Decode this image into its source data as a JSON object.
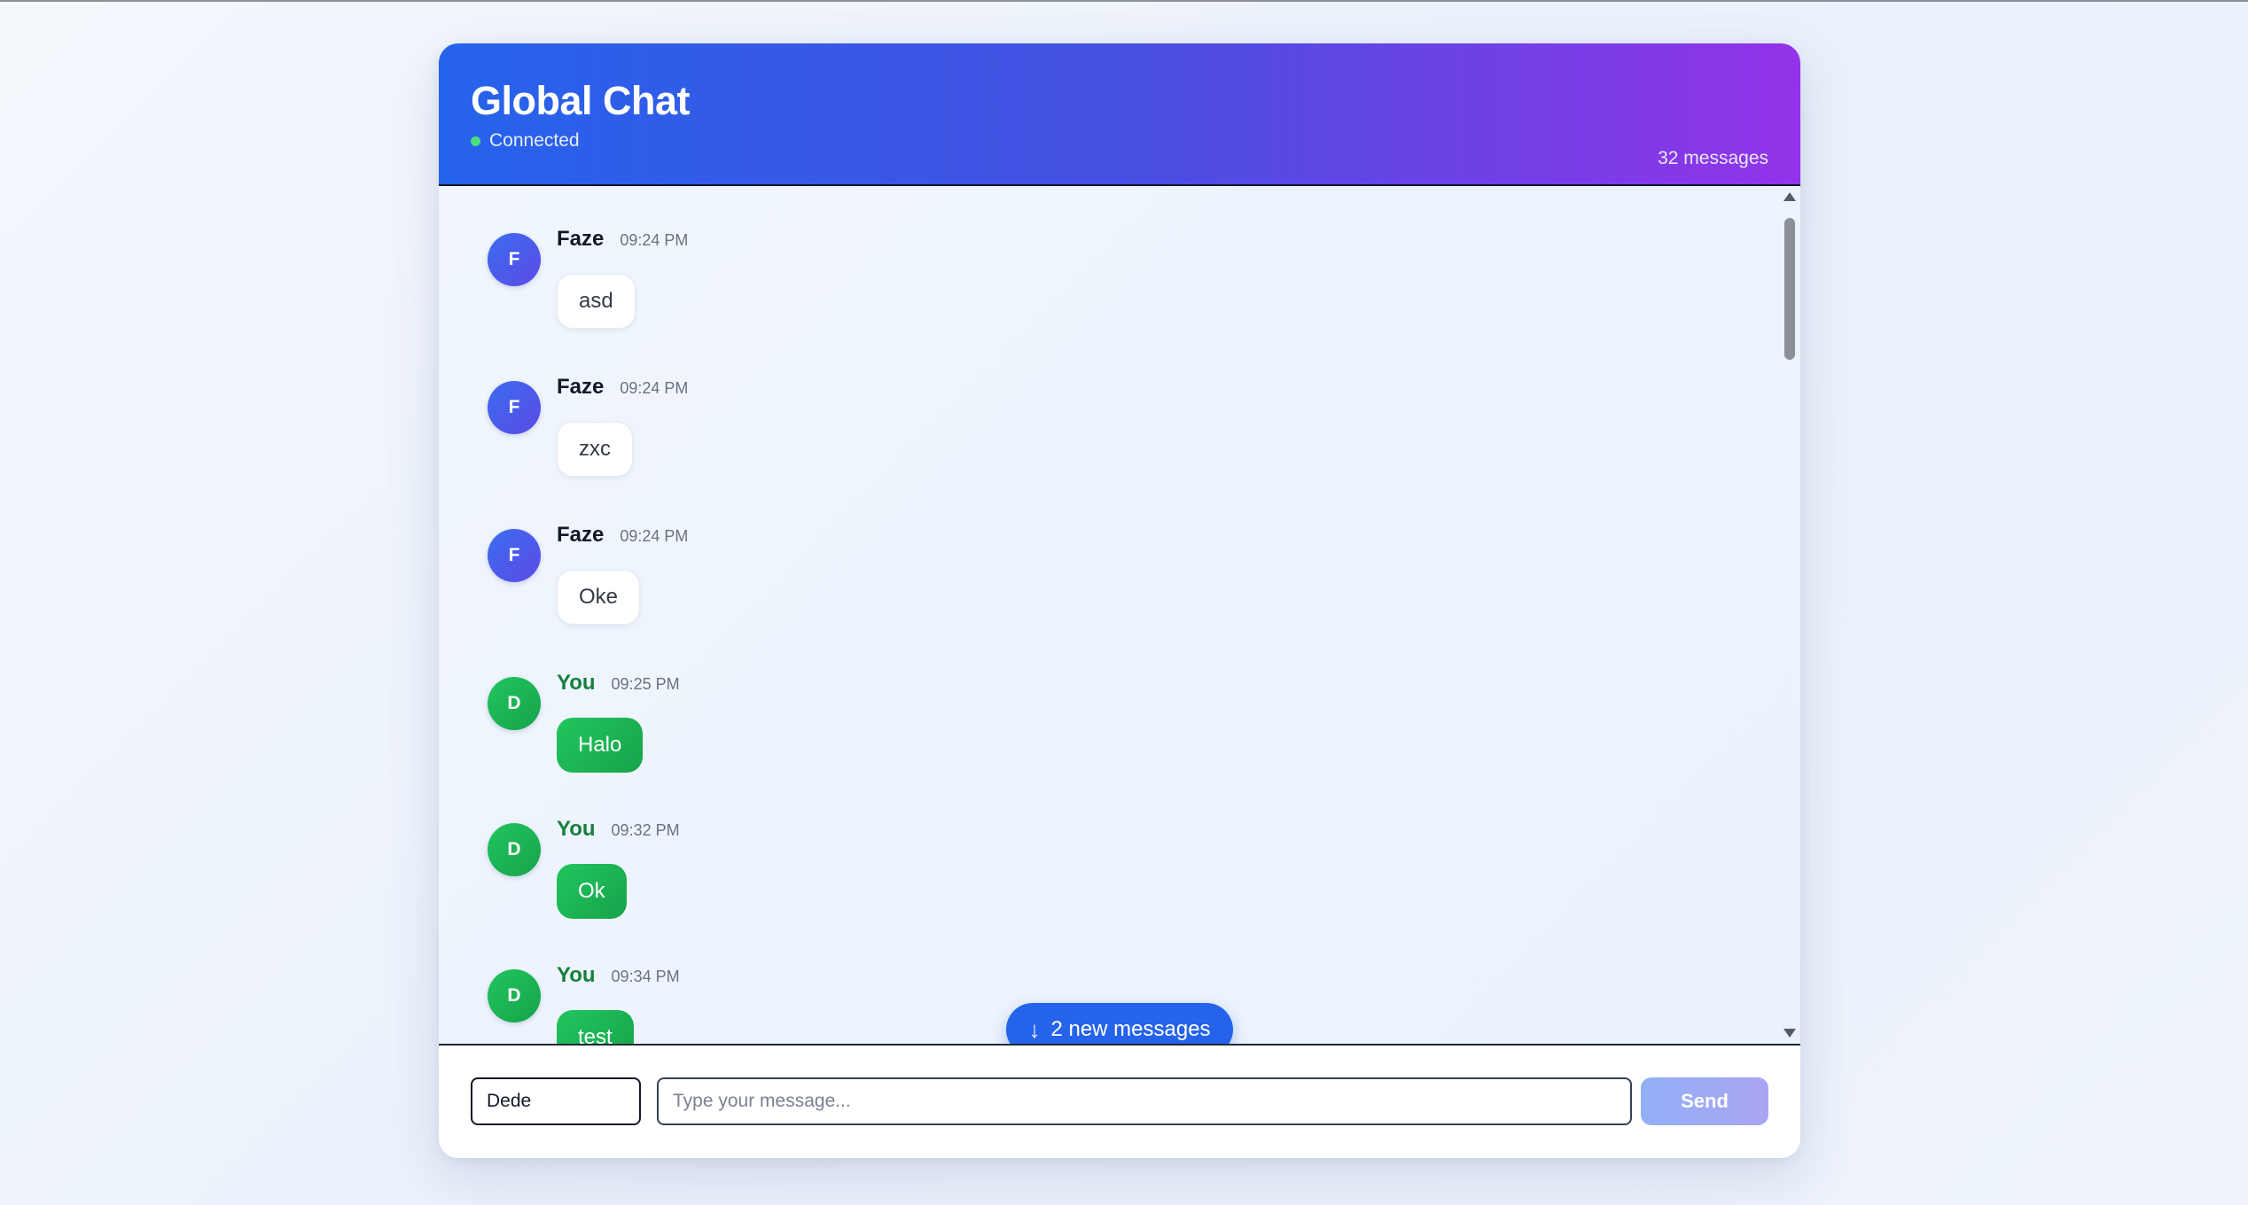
{
  "header": {
    "title": "Global Chat",
    "status": "Connected",
    "message_count": "32 messages"
  },
  "messages": [
    {
      "avatar": "F",
      "sender": "Faze",
      "time": "09:24 PM",
      "text": "asd"
    },
    {
      "avatar": "F",
      "sender": "Faze",
      "time": "09:24 PM",
      "text": "zxc"
    },
    {
      "avatar": "F",
      "sender": "Faze",
      "time": "09:24 PM",
      "text": "Oke"
    },
    {
      "avatar": "D",
      "sender": "You",
      "time": "09:25 PM",
      "text": "Halo"
    },
    {
      "avatar": "D",
      "sender": "You",
      "time": "09:32 PM",
      "text": "Ok"
    },
    {
      "avatar": "D",
      "sender": "You",
      "time": "09:34 PM",
      "text": "test"
    }
  ],
  "new_messages_button": {
    "label": "2 new messages",
    "icon": "arrow-down-icon"
  },
  "composer": {
    "name_value": "Dede",
    "message_placeholder": "Type your message...",
    "send_label": "Send"
  },
  "colors": {
    "header_gradient_start": "#2563eb",
    "header_gradient_end": "#9333ea",
    "status_online": "#4ade80",
    "self_accent": "#16a34a",
    "other_avatar": "#3b6cf0",
    "new_messages_button": "#2563eb"
  }
}
